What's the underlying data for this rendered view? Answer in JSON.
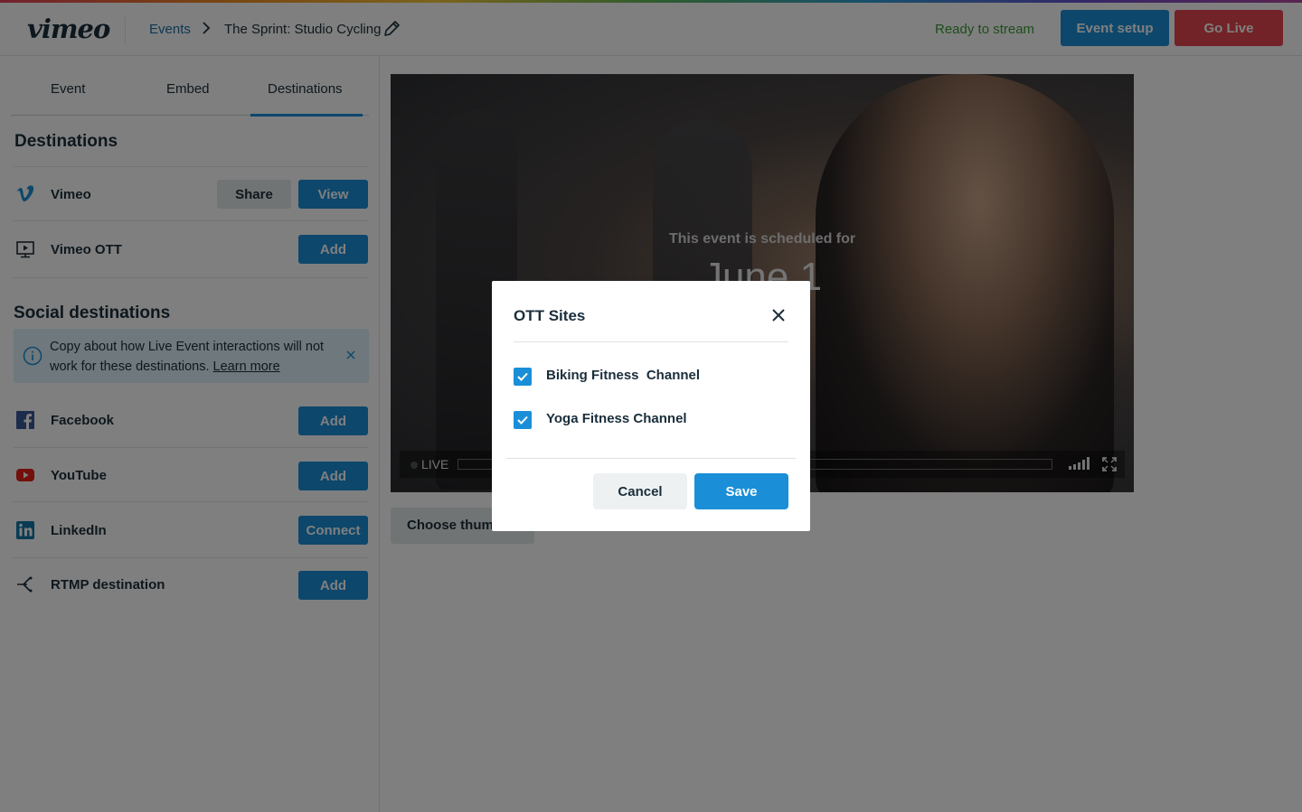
{
  "header": {
    "logo": "vimeo",
    "breadcrumb": {
      "events": "Events",
      "title": "The Sprint: Studio Cycling"
    },
    "status": "Ready to stream",
    "event_setup_label": "Event setup",
    "go_live_label": "Go Live"
  },
  "sidebar": {
    "tabs": [
      {
        "label": "Event"
      },
      {
        "label": "Embed"
      },
      {
        "label": "Destinations",
        "active": true
      }
    ],
    "destinations_title": "Destinations",
    "destinations": [
      {
        "name": "Vimeo",
        "icon": "vimeo-icon",
        "actions": [
          "Share",
          "View"
        ]
      },
      {
        "name": "Vimeo OTT",
        "icon": "vimeo-ott-icon",
        "actions": [
          "Add"
        ]
      }
    ],
    "social_title": "Social destinations",
    "notice": {
      "text": "Copy about how Live Event interactions will not work for these destinations. ",
      "link": "Learn more"
    },
    "social": [
      {
        "name": "Facebook",
        "icon": "facebook-icon",
        "action": "Add"
      },
      {
        "name": "YouTube",
        "icon": "youtube-icon",
        "action": "Add"
      },
      {
        "name": "LinkedIn",
        "icon": "linkedin-icon",
        "action": "Connect"
      },
      {
        "name": "RTMP destination",
        "icon": "rtmp-icon",
        "action": "Add"
      }
    ]
  },
  "player": {
    "scheduled_text": "This event is scheduled for",
    "date": "June 1",
    "live_label": "LIVE",
    "choose_thumbnail_label": "Choose thumbnail"
  },
  "modal": {
    "title": "OTT Sites",
    "options": [
      {
        "label": "Biking Fitness  Channel",
        "checked": true
      },
      {
        "label": "Yoga Fitness Channel",
        "checked": true
      }
    ],
    "cancel_label": "Cancel",
    "save_label": "Save"
  },
  "colors": {
    "accent": "#1a8fd8",
    "go_live": "#e5474f",
    "status_ready": "#3a9c36",
    "notice_bg": "#dcf0fa"
  }
}
